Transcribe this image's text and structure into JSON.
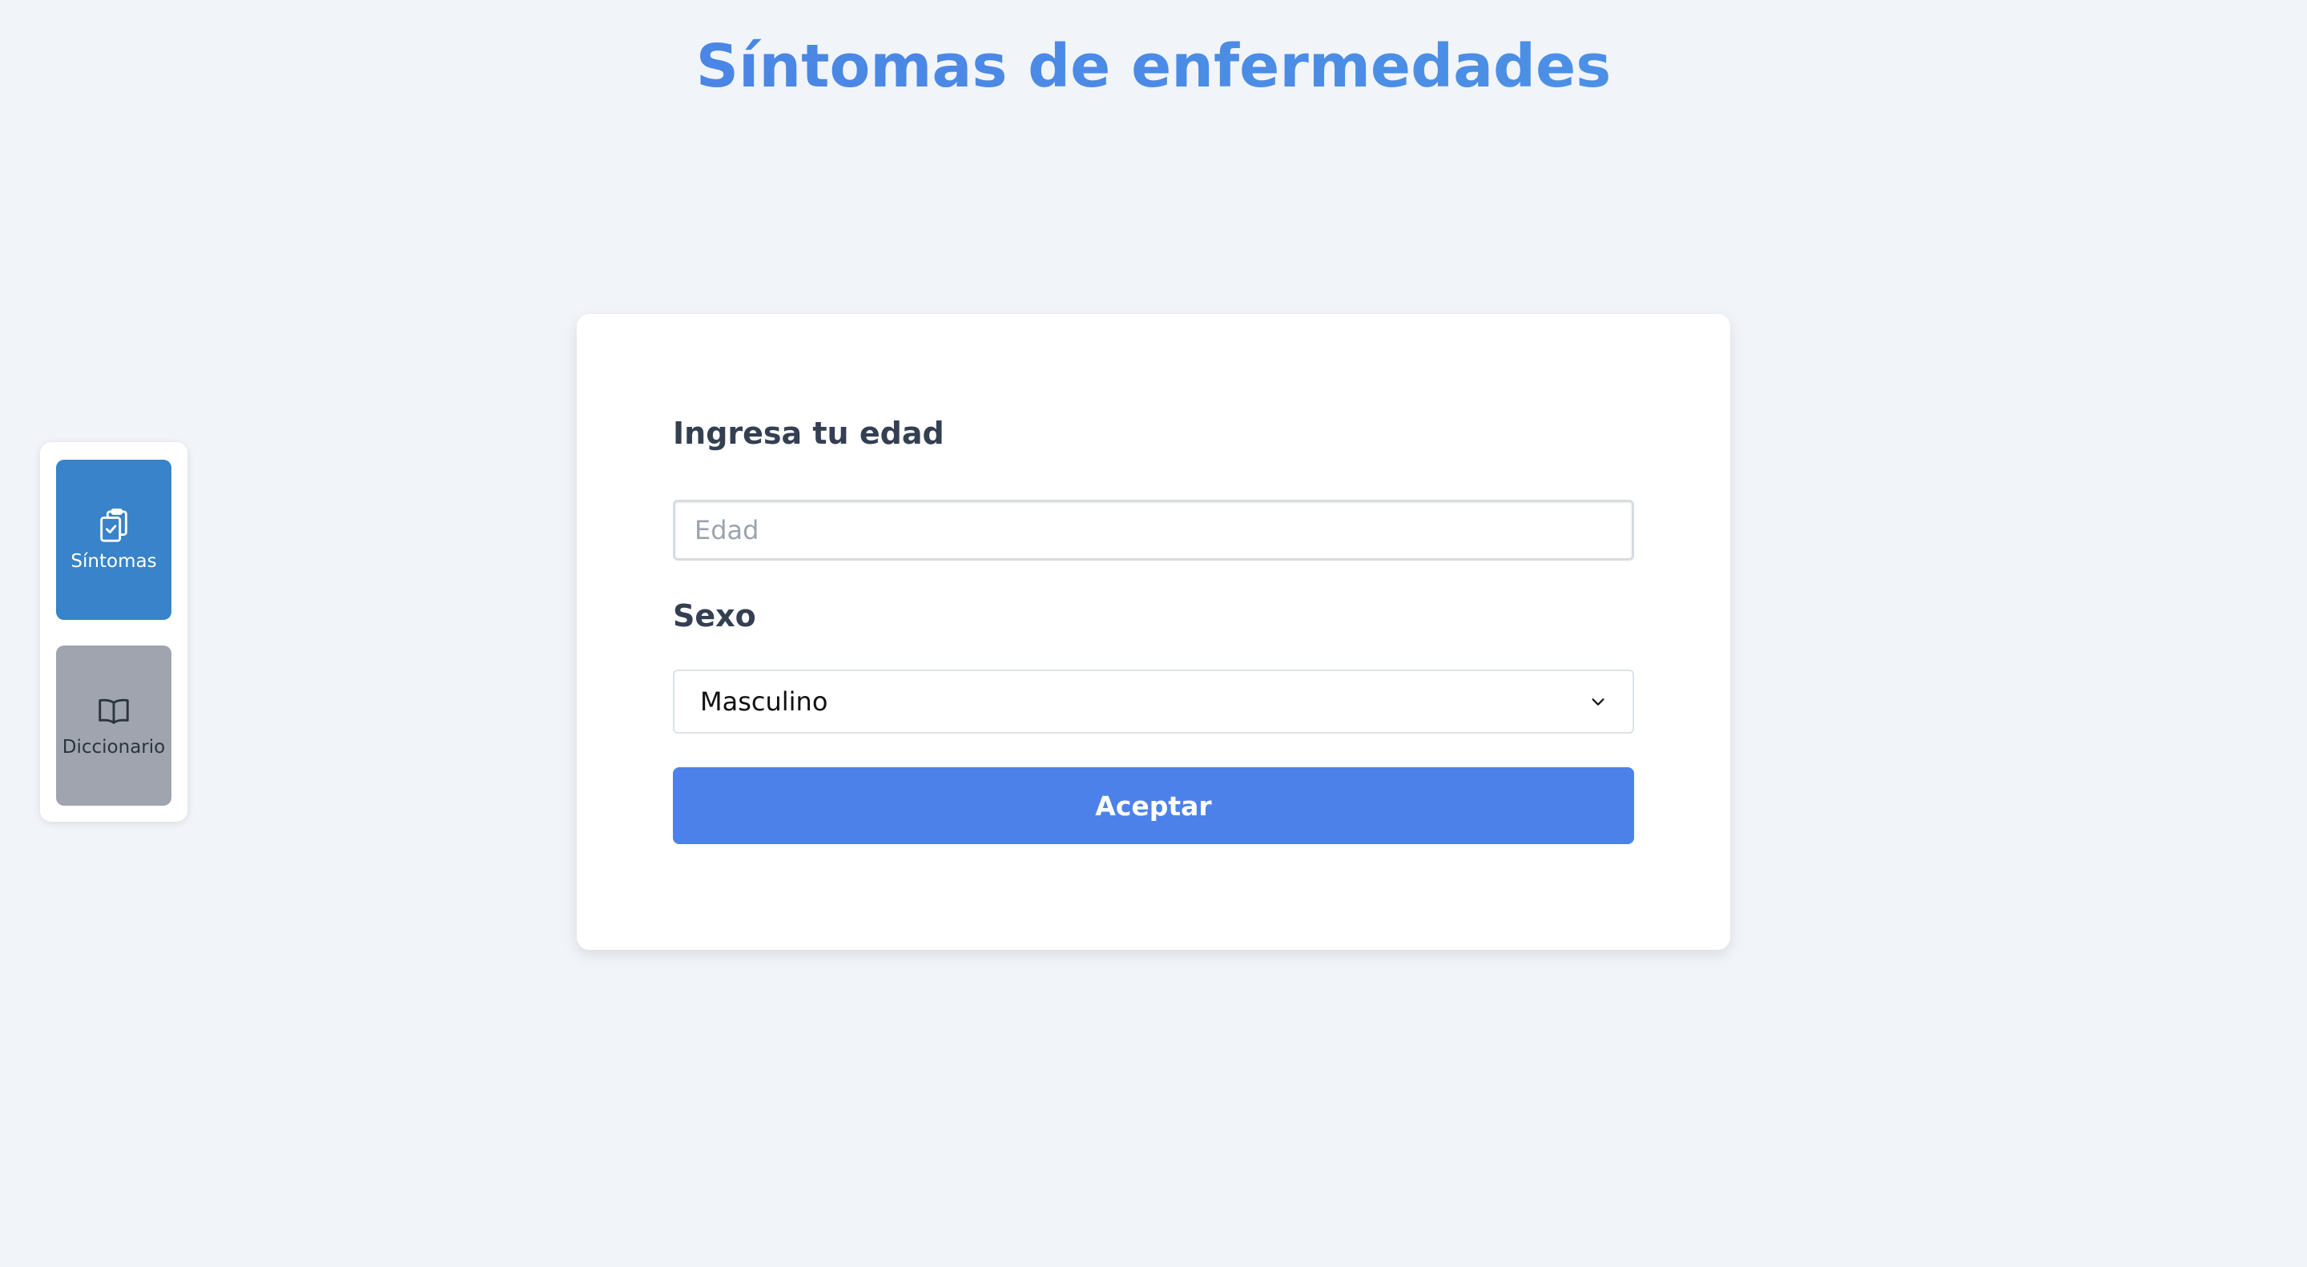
{
  "page": {
    "title": "Síntomas de enfermedades"
  },
  "sidebar": {
    "items": [
      {
        "label": "Síntomas",
        "icon": "clipboard-check-icon",
        "active": true
      },
      {
        "label": "Diccionario",
        "icon": "book-open-icon",
        "active": false
      }
    ]
  },
  "form": {
    "age_label": "Ingresa tu edad",
    "age_placeholder": "Edad",
    "age_value": "",
    "sex_label": "Sexo",
    "sex_selected": "Masculino",
    "submit_label": "Aceptar"
  },
  "colors": {
    "background": "#f1f4f9",
    "title_gradient_start": "#4a7ee6",
    "title_gradient_end": "#4c98e4",
    "nav_active": "#3883c9",
    "nav_inactive": "#9fa4ae",
    "button": "#4d81ea",
    "label_text": "#343f52"
  }
}
